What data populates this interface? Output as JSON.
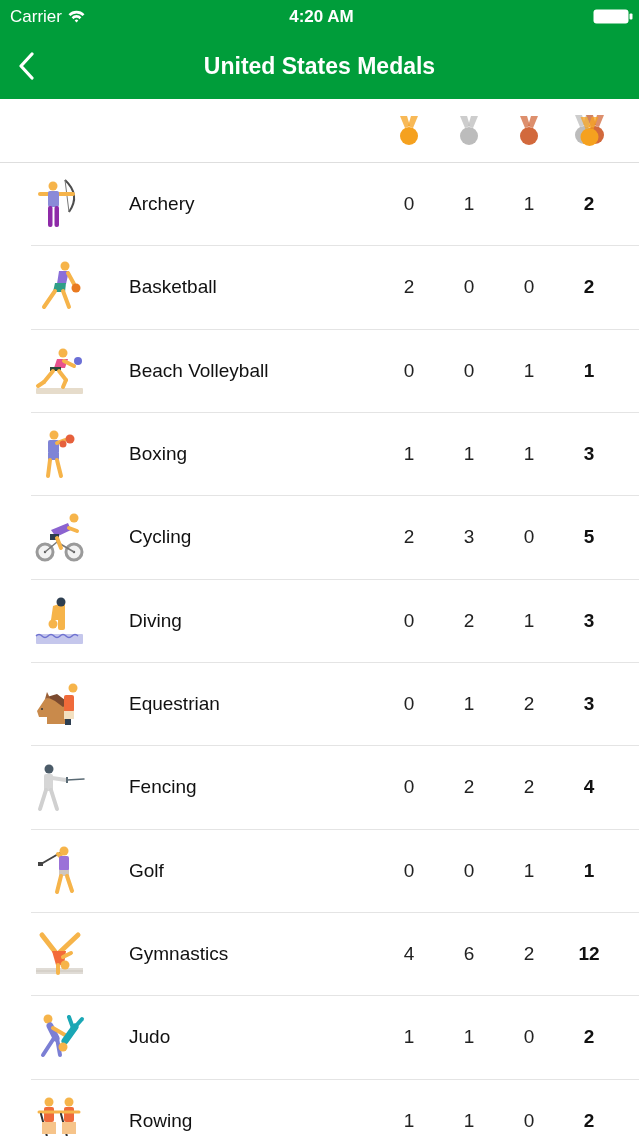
{
  "status_bar": {
    "carrier": "Carrier",
    "time": "4:20 AM"
  },
  "nav_bar": {
    "title": "United States Medals"
  },
  "columns": [
    {
      "kind": "medal",
      "color": "#f5a11f"
    },
    {
      "kind": "medal",
      "color": "#bcbcbc"
    },
    {
      "kind": "medal",
      "color": "#d2693c"
    },
    {
      "kind": "all"
    }
  ],
  "rows": [
    {
      "sport": "Archery",
      "counts": [
        "0",
        "1",
        "1",
        "2"
      ]
    },
    {
      "sport": "Basketball",
      "counts": [
        "2",
        "0",
        "0",
        "2"
      ]
    },
    {
      "sport": "Beach Volleyball",
      "counts": [
        "0",
        "0",
        "1",
        "1"
      ]
    },
    {
      "sport": "Boxing",
      "counts": [
        "1",
        "1",
        "1",
        "3"
      ]
    },
    {
      "sport": "Cycling",
      "counts": [
        "2",
        "3",
        "0",
        "5"
      ]
    },
    {
      "sport": "Diving",
      "counts": [
        "0",
        "2",
        "1",
        "3"
      ]
    },
    {
      "sport": "Equestrian",
      "counts": [
        "0",
        "1",
        "2",
        "3"
      ]
    },
    {
      "sport": "Fencing",
      "counts": [
        "0",
        "2",
        "2",
        "4"
      ]
    },
    {
      "sport": "Golf",
      "counts": [
        "0",
        "0",
        "1",
        "1"
      ]
    },
    {
      "sport": "Gymnastics",
      "counts": [
        "4",
        "6",
        "2",
        "12"
      ]
    },
    {
      "sport": "Judo",
      "counts": [
        "1",
        "1",
        "0",
        "2"
      ]
    },
    {
      "sport": "Rowing",
      "counts": [
        "1",
        "1",
        "0",
        "2"
      ]
    }
  ]
}
